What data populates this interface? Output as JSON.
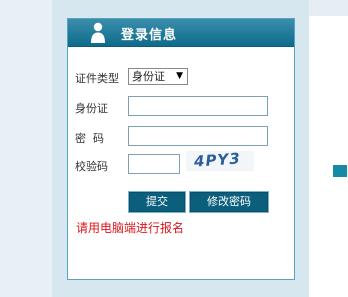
{
  "header": {
    "title": "登录信息"
  },
  "form": {
    "id_type_label": "证件类型",
    "id_type_value": "身份证",
    "id_number_label": "身份证",
    "password_label": "密  码",
    "captcha_label": "校验码",
    "captcha_text": "4PY3"
  },
  "buttons": {
    "submit": "提交",
    "change_password": "修改密码"
  },
  "notice": "请用电脑端进行报名",
  "colors": {
    "header": "#0e6b8c",
    "button": "#0b5f7d",
    "notice": "#d9161c",
    "panel": "#d7e7f0"
  },
  "icons": [
    "user-icon",
    "dropdown-arrow-icon"
  ]
}
